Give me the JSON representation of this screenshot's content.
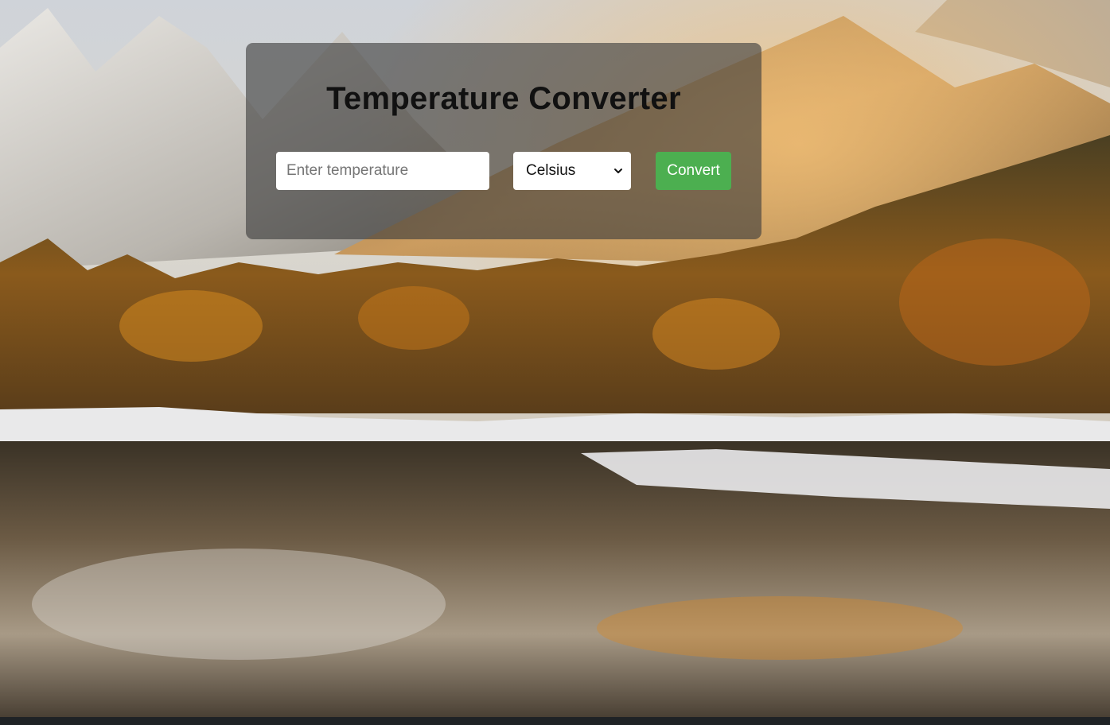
{
  "converter": {
    "title": "Temperature Converter",
    "input_placeholder": "Enter temperature",
    "input_value": "",
    "unit_selected": "Celsius",
    "convert_label": "Convert"
  },
  "colors": {
    "panel_overlay": "#3c3c3c",
    "convert_button": "#4caf50",
    "title_text": "#111111"
  },
  "icons": {
    "select_arrow": "chevron-down-icon"
  }
}
